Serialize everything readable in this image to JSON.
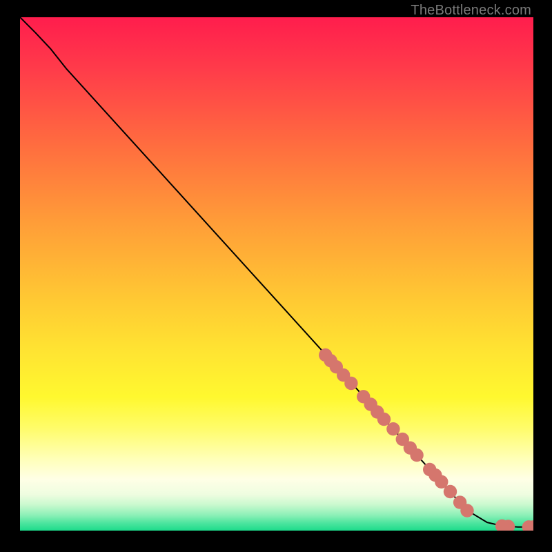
{
  "watermark": "TheBottleneck.com",
  "chart_data": {
    "type": "line",
    "title": "",
    "xlabel": "",
    "ylabel": "",
    "xlim": [
      0,
      100
    ],
    "ylim": [
      0,
      100
    ],
    "grid": false,
    "curve": {
      "name": "bottleneck-curve",
      "color": "#000000",
      "points": [
        {
          "x": 0.0,
          "y": 100.0
        },
        {
          "x": 3.0,
          "y": 97.0
        },
        {
          "x": 6.0,
          "y": 93.8
        },
        {
          "x": 9.0,
          "y": 90.0
        },
        {
          "x": 87.0,
          "y": 4.0
        },
        {
          "x": 91.0,
          "y": 1.6
        },
        {
          "x": 94.0,
          "y": 0.9
        },
        {
          "x": 97.0,
          "y": 0.7
        },
        {
          "x": 100.0,
          "y": 0.7
        }
      ]
    },
    "markers": {
      "name": "data-points",
      "color": "#d5766d",
      "radius_rel": 0.013,
      "points": [
        {
          "x": 59.5,
          "y": 34.2
        },
        {
          "x": 60.5,
          "y": 33.1
        },
        {
          "x": 61.6,
          "y": 31.9
        },
        {
          "x": 63.0,
          "y": 30.3
        },
        {
          "x": 64.5,
          "y": 28.7
        },
        {
          "x": 66.9,
          "y": 26.1
        },
        {
          "x": 68.3,
          "y": 24.6
        },
        {
          "x": 69.6,
          "y": 23.1
        },
        {
          "x": 70.9,
          "y": 21.7
        },
        {
          "x": 72.7,
          "y": 19.8
        },
        {
          "x": 74.5,
          "y": 17.8
        },
        {
          "x": 76.0,
          "y": 16.1
        },
        {
          "x": 77.3,
          "y": 14.7
        },
        {
          "x": 79.8,
          "y": 11.9
        },
        {
          "x": 80.9,
          "y": 10.8
        },
        {
          "x": 82.1,
          "y": 9.5
        },
        {
          "x": 83.8,
          "y": 7.6
        },
        {
          "x": 85.7,
          "y": 5.5
        },
        {
          "x": 87.1,
          "y": 3.9
        },
        {
          "x": 93.9,
          "y": 0.9
        },
        {
          "x": 95.1,
          "y": 0.8
        },
        {
          "x": 99.1,
          "y": 0.7
        },
        {
          "x": 100.0,
          "y": 0.7
        }
      ]
    }
  }
}
